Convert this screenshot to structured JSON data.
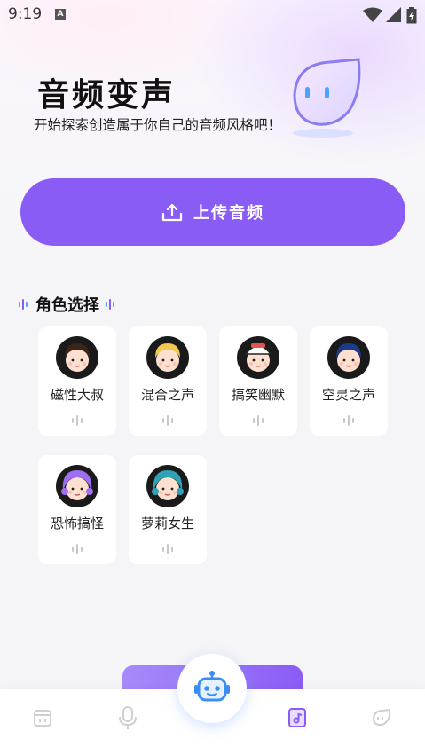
{
  "status_bar": {
    "time": "9:19",
    "notification_badge": "A"
  },
  "header": {
    "title": "音频变声",
    "subtitle": "开始探索创造属于你自己的音频风格吧！"
  },
  "upload": {
    "label": "上传音频",
    "icon": "upload-icon"
  },
  "roles_section": {
    "title": "角色选择",
    "items": [
      {
        "label": "磁性大叔",
        "hair": "#3a2518"
      },
      {
        "label": "混合之声",
        "hair": "#f2c94c"
      },
      {
        "label": "搞笑幽默",
        "hair": "#ffffff"
      },
      {
        "label": "空灵之声",
        "hair": "#1e3a8a"
      },
      {
        "label": "恐怖搞怪",
        "hair": "#a06ef2"
      },
      {
        "label": "萝莉女生",
        "hair": "#2fa3b5"
      }
    ]
  },
  "bottom_nav": {
    "items": [
      {
        "icon": "calendar-icon",
        "active": false
      },
      {
        "icon": "microphone-icon",
        "active": false
      },
      {
        "icon": "robot-icon",
        "active": false
      },
      {
        "icon": "music-file-icon",
        "active": true
      },
      {
        "icon": "leaf-icon",
        "active": false
      }
    ]
  },
  "colors": {
    "accent": "#8a5cf6",
    "background": "#f5f5f7"
  }
}
